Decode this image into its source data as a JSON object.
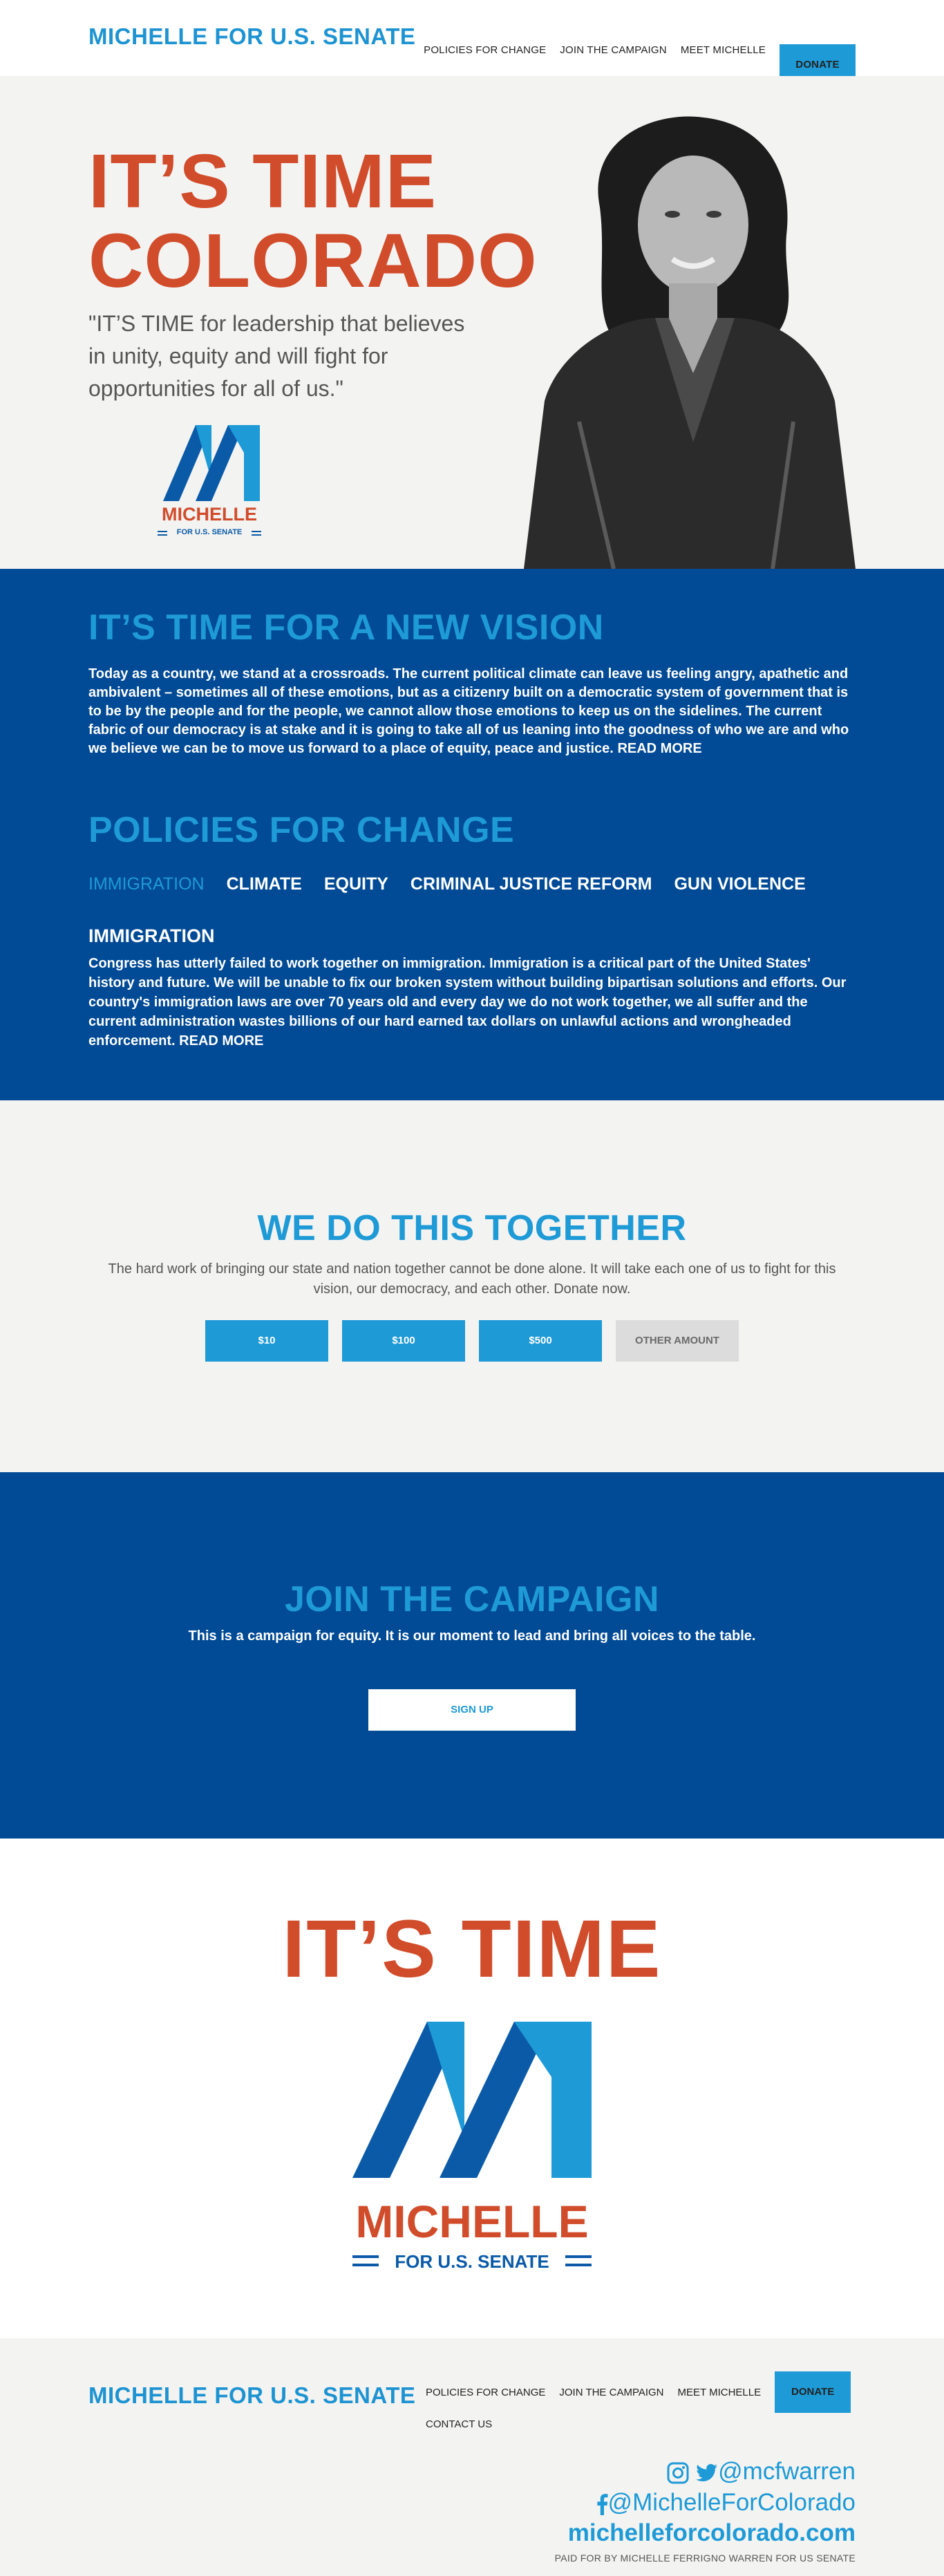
{
  "header": {
    "brand": "MICHELLE FOR U.S. SENATE",
    "nav": [
      "POLICIES FOR CHANGE",
      "JOIN THE CAMPAIGN",
      "MEET MICHELLE"
    ],
    "donate_label": "DONATE"
  },
  "hero": {
    "title_line1": "IT’S TIME",
    "title_line2": "COLORADO",
    "quote": "\"IT’S TIME for leadership that believes in unity, equity and will fight for opportunities for all of us.\"",
    "logo_name": "MICHELLE",
    "logo_sub": "FOR U.S. SENATE"
  },
  "vision": {
    "title": "IT’S TIME FOR A NEW VISION",
    "text": "Today as a country, we stand at a crossroads. The current political climate can leave us feeling angry, apathetic and ambivalent – sometimes all of these emotions, but as a citizenry built on a democratic system of government that is to be by the people and for the people, we cannot allow those emotions to keep us on the sidelines. The current fabric of our democracy is at stake and it is going to take all of us leaning into the goodness of who we are and who we believe we can be to move us forward to a place of equity, peace and justice.",
    "read_more": "READ MORE"
  },
  "policies": {
    "title": "POLICIES FOR CHANGE",
    "tabs": [
      "IMMIGRATION",
      "CLIMATE",
      "EQUITY",
      "CRIMINAL JUSTICE REFORM",
      "GUN VIOLENCE"
    ],
    "active_tab": "IMMIGRATION",
    "heading": "IMMIGRATION",
    "text": "Congress has utterly failed to work together on immigration. Immigration is a critical part of the United States' history and future. We will be unable to fix our broken system without building bipartisan solutions and efforts. Our country's immigration laws are over 70 years old and every day we do not work together, we all suffer and the current administration wastes billions of our hard earned tax dollars on unlawful actions and wrongheaded enforcement.",
    "read_more": "READ MORE"
  },
  "together": {
    "title": "WE DO THIS TOGETHER",
    "text": "The hard work of bringing our state and nation together cannot be done alone. It will take each one of us to fight for this vision, our democracy, and each other. Donate now.",
    "amounts": [
      "$10",
      "$100",
      "$500",
      "OTHER AMOUNT"
    ]
  },
  "join": {
    "title": "JOIN THE CAMPAIGN",
    "text": "This is a campaign for equity. It is our moment to lead and bring all voices to the table.",
    "signup_label": "SIGN UP"
  },
  "bigtime": {
    "title": "IT’S TIME",
    "logo_name": "MICHELLE",
    "logo_sub": "FOR U.S. SENATE"
  },
  "footer": {
    "brand": "MICHELLE FOR U.S. SENATE",
    "nav": [
      "POLICIES FOR CHANGE",
      "JOIN THE CAMPAIGN",
      "MEET MICHELLE"
    ],
    "donate_label": "DONATE",
    "contact": "CONTACT US",
    "handle_social": "@mcfwarren",
    "handle_facebook": "@MichelleForColorado",
    "website": "michelleforcolorado.com",
    "paid_for": "PAID FOR BY MICHELLE FERRIGNO WARREN FOR US SENATE"
  },
  "colors": {
    "brand_blue": "#1e9ad6",
    "navy": "#004a96",
    "orange": "#d14c2b",
    "light_gray": "#f3f3f2"
  },
  "icons": [
    "instagram-icon",
    "twitter-icon",
    "facebook-icon"
  ]
}
